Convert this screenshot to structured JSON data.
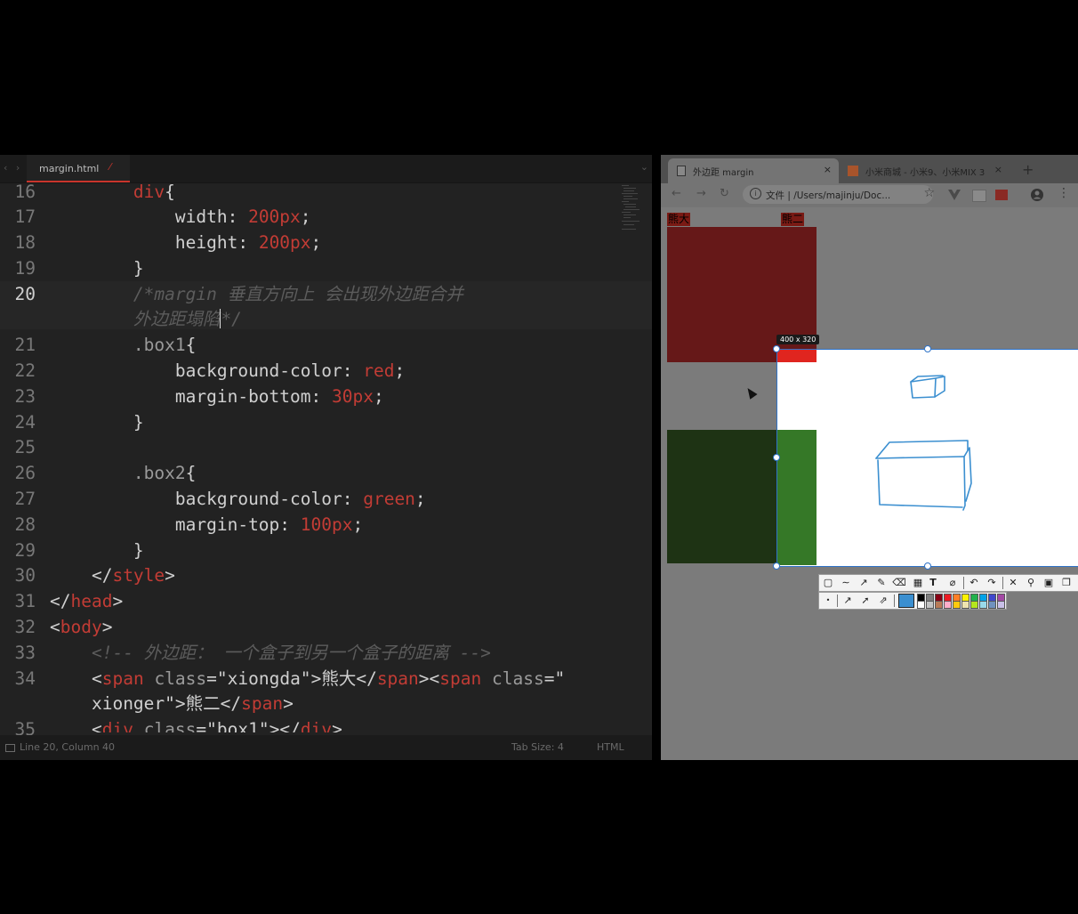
{
  "editor": {
    "tab_label": "margin.html",
    "tab_modified": "✓",
    "nav": "‹ ›",
    "line_numbers": [
      "16",
      "17",
      "18",
      "19",
      "20",
      "",
      "21",
      "22",
      "23",
      "24",
      "25",
      "26",
      "27",
      "28",
      "29",
      "30",
      "31",
      "32",
      "33",
      "34",
      "",
      "35"
    ],
    "code": {
      "l16_sel": "div",
      "l16_br": "{",
      "l17_prop": "width",
      "l17_val": "200px",
      "l18_prop": "height",
      "l18_val": "200px",
      "l19": "}",
      "l20a": "/*margin 垂直方向上 会出现外边距合并",
      "l20b_pre": "外边距塌陷",
      "l20b_post": "*/",
      "l21_sel": ".box1",
      "l21_br": "{",
      "l22_prop": "background-color",
      "l22_val": "red",
      "l23_prop": "margin-bottom",
      "l23_val": "30px",
      "l24": "}",
      "l26_sel": ".box2",
      "l26_br": "{",
      "l27_prop": "background-color",
      "l27_val": "green",
      "l28_prop": "margin-top",
      "l28_val": "100px",
      "l29": "}",
      "l30_tag": "style",
      "l31_tag": "head",
      "l32_tag": "body",
      "l33_comment": "<!-- 外边距： 一个盒子到另一个盒子的距离 -->",
      "l34_tag": "span",
      "l34_attr": "class",
      "l34_str": "\"xiongda\"",
      "l34_text": "熊大",
      "l34_attr2": "class",
      "l34_str2a": "\"",
      "l34b_str": "xionger\"",
      "l34b_text": "熊二",
      "l35_tag": "div",
      "l35_attr": "class",
      "l35_str": "\"box1\""
    },
    "status": {
      "position": "Line 20, Column 40",
      "tab_size": "Tab Size: 4",
      "language": "HTML"
    }
  },
  "browser": {
    "tabs": [
      {
        "title": "外边距 margin",
        "close": "×"
      },
      {
        "title": "小米商城 - 小米9、小米MIX 3",
        "close": "×"
      }
    ],
    "new_tab": "+",
    "back": "←",
    "forward": "→",
    "reload": "↻",
    "address_prefix": "文件",
    "address": "/Users/majinju/Doc...",
    "bookmark": "☆",
    "page": {
      "label_xiongda": "熊大",
      "label_xionger": "熊二"
    },
    "snip": {
      "size_label": "400 x 320",
      "tools": [
        "▢",
        "∼",
        "↗",
        "✎",
        "⌫",
        "▦",
        "T",
        "⌀",
        "↶",
        "↷",
        "✕",
        "⚲",
        "▣",
        "❐"
      ],
      "colors": [
        "#000000",
        "#7f7f7f",
        "#880015",
        "#ed1c24",
        "#ff7f27",
        "#fff200",
        "#22b14c",
        "#00a2e8",
        "#3f48cc",
        "#a349a4",
        "#ffffff",
        "#c3c3c3",
        "#b97a57",
        "#ffaec9",
        "#ffc90e",
        "#efe4b0",
        "#b5e61d",
        "#99d9ea",
        "#7092be",
        "#c8bfe7"
      ]
    }
  }
}
